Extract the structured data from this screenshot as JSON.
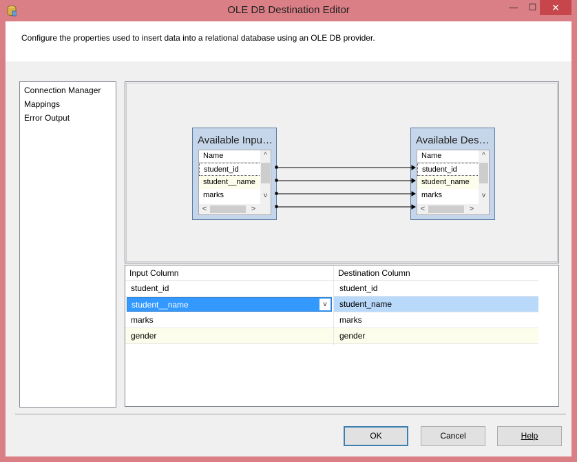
{
  "window": {
    "title": "OLE DB Destination Editor",
    "minimize_glyph": "—",
    "maximize_glyph": "☐",
    "close_glyph": "✕",
    "app_icon": "database-cylinder-icon"
  },
  "header": {
    "description": "Configure the properties used to insert data into a relational database using an OLE DB provider."
  },
  "nav": {
    "items": [
      {
        "label": "Connection Manager"
      },
      {
        "label": "Mappings"
      },
      {
        "label": "Error Output"
      }
    ]
  },
  "diagram": {
    "input_box": {
      "title": "Available Inpu…",
      "header": "Name",
      "rows": [
        "student_id",
        "student__name",
        "marks"
      ]
    },
    "dest_box": {
      "title": "Available Des…",
      "header": "Name",
      "rows": [
        "student_id",
        "student_name",
        "marks"
      ]
    },
    "scroll": {
      "up": "^",
      "down": "v",
      "left": "<",
      "right": ">"
    }
  },
  "grid": {
    "headers": {
      "input": "Input Column",
      "destination": "Destination Column"
    },
    "rows": [
      {
        "input": "student_id",
        "destination": "student_id"
      },
      {
        "input": "student__name",
        "destination": "student_name"
      },
      {
        "input": "marks",
        "destination": "marks"
      },
      {
        "input": "gender",
        "destination": "gender"
      }
    ],
    "combo_arrow": "v"
  },
  "buttons": {
    "ok": "OK",
    "cancel": "Cancel",
    "help": "Help"
  },
  "colors": {
    "selection": "#3399ff",
    "row_highlight": "#fdfdeb",
    "selected_row_light": "#b9d9fb",
    "window_frame": "#db7f86"
  }
}
